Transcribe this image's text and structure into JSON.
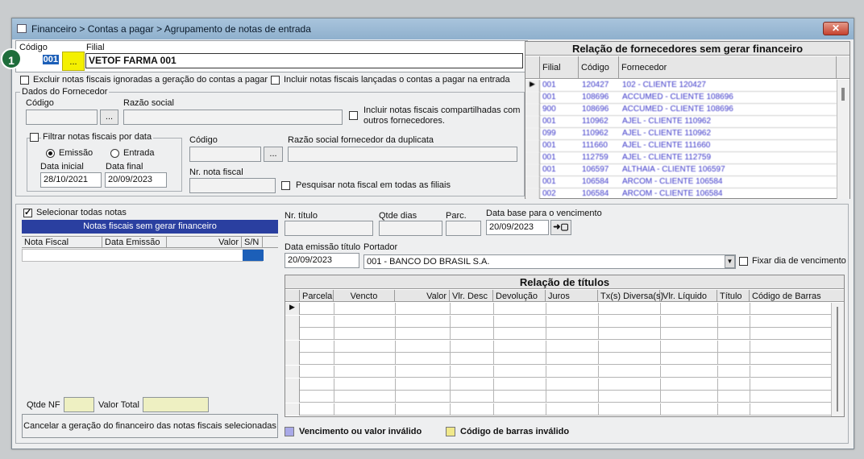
{
  "window": {
    "title": "Financeiro > Contas a pagar > Agrupamento de notas de entrada",
    "close_glyph": "✕"
  },
  "callout": {
    "number": "1"
  },
  "header": {
    "codigo_label": "Código",
    "filial_label": "Filial",
    "codigo_value": "001",
    "lookup_label": "...",
    "filial_value": "VETOF FARMA 001"
  },
  "options": {
    "excluir_label": "Excluir notas fiscais ignoradas a geração do contas a pagar",
    "incluir_lancadas_label": "Incluir notas fiscais lançadas o contas a pagar na entrada"
  },
  "fornecedor": {
    "group_label": "Dados do Fornecedor",
    "codigo_label": "Código",
    "razao_label": "Razão social",
    "lookup_label": "...",
    "compartilhadas_label_1": "Incluir notas fiscais compartilhadas com",
    "compartilhadas_label_2": "outros fornecedores."
  },
  "filtro": {
    "group_label": "Filtrar notas fiscais por data",
    "emissao_label": "Emissão",
    "entrada_label": "Entrada",
    "data_inicial_label": "Data inicial",
    "data_final_label": "Data final",
    "data_inicial_value": "28/10/2021",
    "data_final_value": "20/09/2023"
  },
  "duplicata": {
    "codigo_label": "Código",
    "razao_label": "Razão social fornecedor da duplicata",
    "lookup_label": "...",
    "nota_label": "Nr. nota fiscal",
    "pesquisar_label": "Pesquisar nota fiscal em todas as filiais"
  },
  "suppliers": {
    "title": "Relação de fornecedores sem gerar financeiro",
    "columns": [
      "Filial",
      "Código",
      "Fornecedor"
    ],
    "rows": [
      [
        "001",
        "120427",
        "102 - CLIENTE 120427"
      ],
      [
        "001",
        "108696",
        "ACCUMED - CLIENTE 108696"
      ],
      [
        "900",
        "108696",
        "ACCUMED - CLIENTE 108696"
      ],
      [
        "001",
        "110962",
        "AJEL - CLIENTE 110962"
      ],
      [
        "099",
        "110962",
        "AJEL - CLIENTE 110962"
      ],
      [
        "001",
        "111660",
        "AJEL - CLIENTE 111660"
      ],
      [
        "001",
        "112759",
        "AJEL - CLIENTE 112759"
      ],
      [
        "001",
        "106597",
        "ALTHAIA - CLIENTE 106597"
      ],
      [
        "001",
        "106584",
        "ARCOM - CLIENTE 106584"
      ],
      [
        "002",
        "106584",
        "ARCOM - CLIENTE 106584"
      ]
    ]
  },
  "notas": {
    "select_all_label": "Selecionar todas notas",
    "title": "Notas fiscais sem gerar financeiro",
    "columns": [
      "Nota Fiscal",
      "Data Emissão",
      "Valor",
      "S/N"
    ],
    "qtde_label": "Qtde NF",
    "valor_total_label": "Valor Total",
    "cancel_label": "Cancelar a geração do financeiro das notas fiscais selecionadas"
  },
  "titulo": {
    "nr_label": "Nr. título",
    "qtde_dias_label": "Qtde dias",
    "parc_label": "Parc.",
    "data_base_label": "Data base para o vencimento",
    "data_base_value": "20/09/2023",
    "apply_glyph": "➜▢",
    "emissao_label": "Data emissão título",
    "emissao_value": "20/09/2023",
    "portador_label": "Portador",
    "portador_value": "001 - BANCO DO BRASIL S.A.",
    "fixar_label": "Fixar dia de vencimento"
  },
  "titulos": {
    "title": "Relação de títulos",
    "columns": [
      "Parcela",
      "Vencto",
      "Valor",
      "Vlr. Desc",
      "Devolução",
      "Juros",
      "Tx(s) Diversa(s)",
      "Vlr. Líquido",
      "Título",
      "Código de Barras"
    ]
  },
  "legend": {
    "invalid_due_label": "Vencimento ou valor inválido",
    "invalid_due_color": "#a9a9e8",
    "invalid_barcode_label": "Código de barras inválido",
    "invalid_barcode_color": "#f0e88a"
  },
  "colors": {
    "titlebar": "#9bb8d4",
    "grid_title": "#2a3fa0",
    "supplier_text": "#3a36c8",
    "callout": "#1e6d3b",
    "highlight": "#f4f000"
  }
}
